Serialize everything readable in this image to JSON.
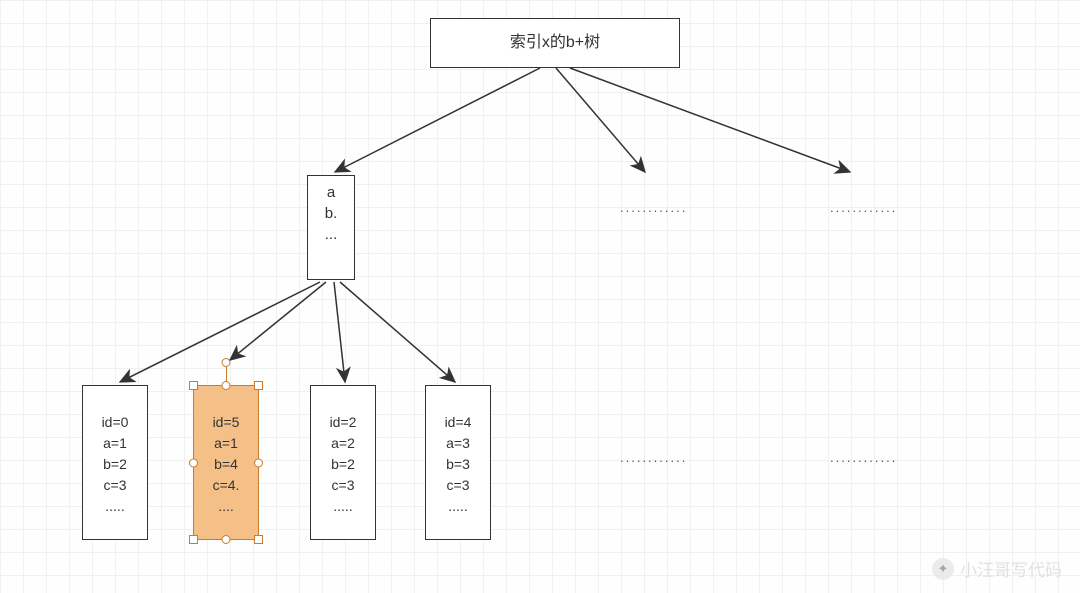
{
  "root": {
    "label": "索引x的b+树"
  },
  "mid": {
    "line1": "a",
    "line2": "b.",
    "line3": "..."
  },
  "leaves": [
    {
      "id": "id=0",
      "a": "a=1",
      "b": "b=2",
      "c": "c=3",
      "more": "....."
    },
    {
      "id": "id=5",
      "a": "a=1",
      "b": "b=4",
      "c": "c=4.",
      "more": "...."
    },
    {
      "id": "id=2",
      "a": "a=2",
      "b": "b=2",
      "c": "c=3",
      "more": "....."
    },
    {
      "id": "id=4",
      "a": "a=3",
      "b": "b=3",
      "c": "c=3",
      "more": "....."
    }
  ],
  "ellipsis": "............",
  "watermark": {
    "text": "小汪哥写代码"
  }
}
